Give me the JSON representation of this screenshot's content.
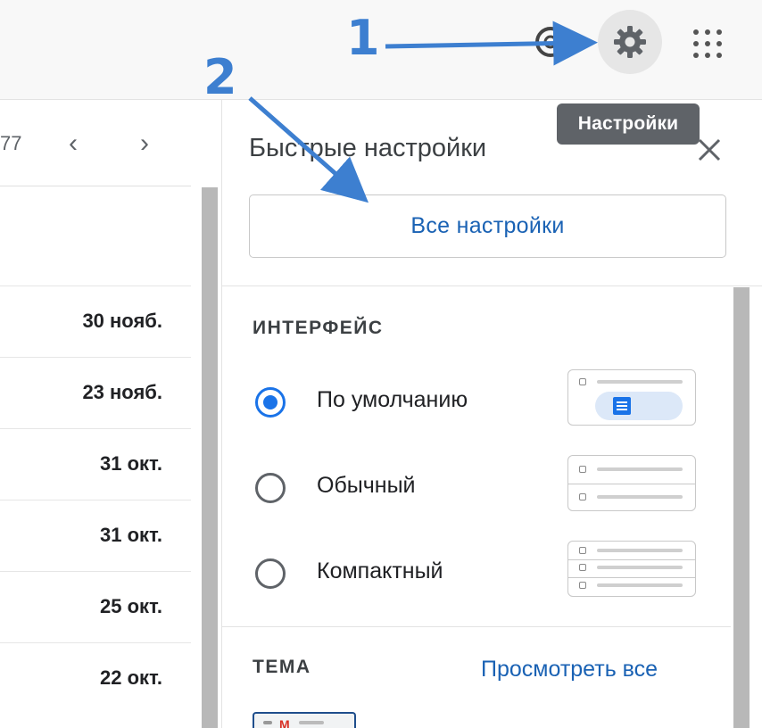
{
  "topbar": {
    "icons": [
      "support-icon",
      "settings-gear-icon",
      "apps-grid-icon"
    ],
    "tooltip": "Настройки"
  },
  "annotations": {
    "step1": "1",
    "step2": "2",
    "arrow_color": "#3d7fd0"
  },
  "mail_list": {
    "pager_count": "77",
    "prev_icon": "‹",
    "next_icon": "›",
    "dates": [
      "30 нояб.",
      "23 нояб.",
      "31 окт.",
      "31 окт.",
      "25 окт.",
      "22 окт."
    ]
  },
  "quick_settings": {
    "title": "Быстрые настройки",
    "close_icon": "close-icon",
    "all_settings": "Все настройки",
    "density": {
      "label": "ИНТЕРФЕЙС",
      "options": [
        {
          "label": "По умолчанию",
          "selected": true
        },
        {
          "label": "Обычный",
          "selected": false
        },
        {
          "label": "Компактный",
          "selected": false
        }
      ]
    },
    "theme": {
      "label": "ТЕМА",
      "view_all": "Просмотреть все"
    }
  },
  "colors": {
    "accent": "#1a73e8",
    "link": "#1a62b4",
    "tooltip_bg": "#5f6368"
  }
}
